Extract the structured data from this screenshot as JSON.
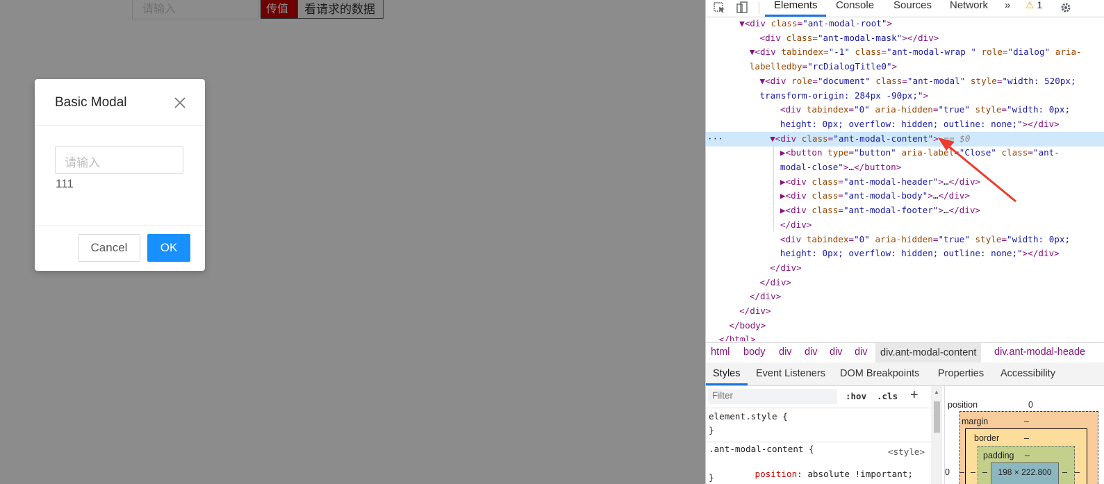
{
  "app": {
    "top_input_placeholder": "请输入",
    "pass_button": "传值",
    "view_button": "看请求的数据"
  },
  "modal": {
    "title": "Basic Modal",
    "input_placeholder": "请输入",
    "body_text": "111",
    "cancel_label": "Cancel",
    "ok_label": "OK",
    "ok_color": "#1890ff"
  },
  "devtools": {
    "tabs": [
      "Elements",
      "Console",
      "Sources",
      "Network",
      "»"
    ],
    "warning_count": "1",
    "dom": [
      {
        "indent": 3,
        "html": "▼<span class='tag'>&lt;div</span> <span class='attr'>class</span>=<span class='val'>\"ant-modal-root\"</span><span class='tag'>&gt;</span>"
      },
      {
        "indent": 5,
        "html": "<span class='tag'>&lt;div</span> <span class='attr'>class</span>=<span class='val'>\"ant-modal-mask\"</span><span class='tag'>&gt;&lt;/div&gt;</span>"
      },
      {
        "indent": 4,
        "html": "▼<span class='tag'>&lt;div</span> <span class='attr'>tabindex</span>=<span class='val'>\"-1\"</span> <span class='attr'>class</span>=<span class='val'>\"ant-modal-wrap \"</span> <span class='attr'>role</span>=<span class='val'>\"dialog\"</span> <span class='attr'>aria-</span>"
      },
      {
        "indent": 4,
        "html": "<span class='attr'>labelledby</span>=<span class='val'>\"rcDialogTitle0\"</span><span class='tag'>&gt;</span>"
      },
      {
        "indent": 5,
        "html": "▼<span class='tag'>&lt;div</span> <span class='attr'>role</span>=<span class='val'>\"document\"</span> <span class='attr'>class</span>=<span class='val'>\"ant-modal\"</span> <span class='attr'>style</span>=<span class='val'>\"width: 520px;</span>"
      },
      {
        "indent": 5,
        "html": "<span class='val'>transform-origin: 284px -90px;\"</span><span class='tag'>&gt;</span>"
      },
      {
        "indent": 7,
        "html": "<span class='tag'>&lt;div</span> <span class='attr'>tabindex</span>=<span class='val'>\"0\"</span> <span class='attr'>aria-hidden</span>=<span class='val'>\"true\"</span> <span class='attr'>style</span>=<span class='val'>\"width: 0px;</span>"
      },
      {
        "indent": 7,
        "html": "<span class='val'>height: 0px; overflow: hidden; outline: none;\"</span><span class='tag'>&gt;&lt;/div&gt;</span>"
      },
      {
        "indent": 6,
        "selected": true,
        "html": "▼<span class='tag'>&lt;div</span> <span class='attr'>class</span>=<span class='val'>\"ant-modal-content\"</span><span class='tag'>&gt;</span> <span class='dim'>== <i>$0</i></span>"
      },
      {
        "indent": 7,
        "html": "▶<span class='tag'>&lt;button</span> <span class='attr'>type</span>=<span class='val'>\"button\"</span> <span class='attr'>aria-label</span>=<span class='val'>\"Close\"</span> <span class='attr'>class</span>=<span class='val'>\"ant-</span>"
      },
      {
        "indent": 7,
        "html": "<span class='val'>modal-close\"</span><span class='tag'>&gt;</span><span class='txt'>…</span><span class='tag'>&lt;/button&gt;</span>"
      },
      {
        "indent": 7,
        "html": "▶<span class='tag'>&lt;div</span> <span class='attr'>class</span>=<span class='val'>\"ant-modal-header\"</span><span class='tag'>&gt;</span><span class='txt'>…</span><span class='tag'>&lt;/div&gt;</span>"
      },
      {
        "indent": 7,
        "html": "▶<span class='tag'>&lt;div</span> <span class='attr'>class</span>=<span class='val'>\"ant-modal-body\"</span><span class='tag'>&gt;</span><span class='txt'>…</span><span class='tag'>&lt;/div&gt;</span>"
      },
      {
        "indent": 7,
        "html": "▶<span class='tag'>&lt;div</span> <span class='attr'>class</span>=<span class='val'>\"ant-modal-footer\"</span><span class='tag'>&gt;</span><span class='txt'>…</span><span class='tag'>&lt;/div&gt;</span>"
      },
      {
        "indent": 7,
        "html": "<span class='tag'>&lt;/div&gt;</span>"
      },
      {
        "indent": 7,
        "html": "<span class='tag'>&lt;div</span> <span class='attr'>tabindex</span>=<span class='val'>\"0\"</span> <span class='attr'>aria-hidden</span>=<span class='val'>\"true\"</span> <span class='attr'>style</span>=<span class='val'>\"width: 0px;</span>"
      },
      {
        "indent": 7,
        "html": "<span class='val'>height: 0px; overflow: hidden; outline: none;\"</span><span class='tag'>&gt;&lt;/div&gt;</span>"
      },
      {
        "indent": 6,
        "html": "<span class='tag'>&lt;/div&gt;</span>"
      },
      {
        "indent": 5,
        "html": "<span class='tag'>&lt;/div&gt;</span>"
      },
      {
        "indent": 4,
        "html": "<span class='tag'>&lt;/div&gt;</span>"
      },
      {
        "indent": 3,
        "html": "<span class='tag'>&lt;/div&gt;</span>"
      },
      {
        "indent": 2,
        "html": "<span class='tag'>&lt;/body&gt;</span>"
      },
      {
        "indent": 1,
        "html": "<span class='tag'>&lt;/html&gt;</span>"
      }
    ],
    "breadcrumbs": [
      "html",
      "body",
      "div",
      "div",
      "div",
      "div"
    ],
    "breadcrumb_active": "div.ant-modal-content",
    "breadcrumb_next": "div.ant-modal-heade",
    "subtabs": [
      "Styles",
      "Event Listeners",
      "DOM Breakpoints",
      "Properties",
      "Accessibility"
    ],
    "filter_placeholder": "Filter",
    "hov_label": ":hov",
    "cls_label": ".cls",
    "plus_label": "+",
    "styles": {
      "element_style_open": "element.style {",
      "element_style_close": "}",
      "rule_selector": ".ant-modal-content {",
      "rule_source": "<style>",
      "rule_prop": "position",
      "rule_value": ": absolute !important;",
      "rule_close": "}"
    },
    "box_model": {
      "position_label": "position",
      "position_value": "0",
      "margin_label": "margin",
      "margin_value": "–",
      "border_label": "border",
      "border_value": "–",
      "padding_label": "padding",
      "padding_value": "–",
      "content_size": "198 × 222.800",
      "side_dash": "–",
      "left_zero": "0"
    }
  }
}
